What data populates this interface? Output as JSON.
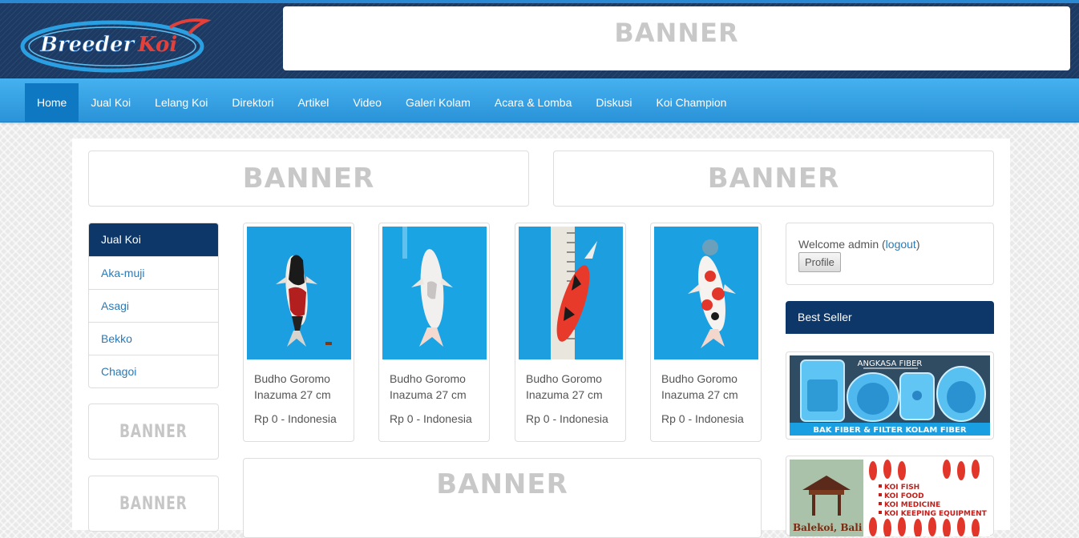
{
  "header": {
    "logo_text": "Breeder Koi",
    "top_banner": "BANNER"
  },
  "nav": {
    "items": [
      {
        "label": "Home",
        "active": true
      },
      {
        "label": "Jual Koi"
      },
      {
        "label": "Lelang Koi"
      },
      {
        "label": "Direktori"
      },
      {
        "label": "Artikel"
      },
      {
        "label": "Video"
      },
      {
        "label": "Galeri Kolam"
      },
      {
        "label": "Acara & Lomba"
      },
      {
        "label": "Diskusi"
      },
      {
        "label": "Koi Champion"
      }
    ]
  },
  "banners": {
    "left": "BANNER",
    "right": "BANNER",
    "side_1": "BANNER",
    "side_2": "BANNER",
    "bottom": "BANNER"
  },
  "sidebar": {
    "heading": "Jual Koi",
    "items": [
      "Aka-muji",
      "Asagi",
      "Bekko",
      "Chagoi"
    ]
  },
  "products": [
    {
      "name": "Budho Goromo Inazuma 27 cm",
      "price": "Rp 0 - Indonesia"
    },
    {
      "name": "Budho Goromo Inazuma 27 cm",
      "price": "Rp 0 - Indonesia"
    },
    {
      "name": "Budho Goromo Inazuma 27 cm",
      "price": "Rp 0 - Indonesia"
    },
    {
      "name": "Budho Goromo Inazuma 27 cm",
      "price": "Rp 0 - Indonesia"
    }
  ],
  "user": {
    "welcome_prefix": "Welcome admin (",
    "logout_label": "logout",
    "welcome_suffix": ")",
    "profile_button": "Profile"
  },
  "best_seller": {
    "heading": "Best Seller",
    "ad1": {
      "title": "ANGKASA FIBER",
      "caption": "BAK FIBER & FILTER KOLAM FIBER"
    },
    "ad2": {
      "lines": [
        "KOI FISH",
        "KOI FOOD",
        "KOI MEDICINE",
        "KOI KEEPING EQUIPMENT"
      ],
      "brand": "Balekoi, Bali"
    }
  }
}
